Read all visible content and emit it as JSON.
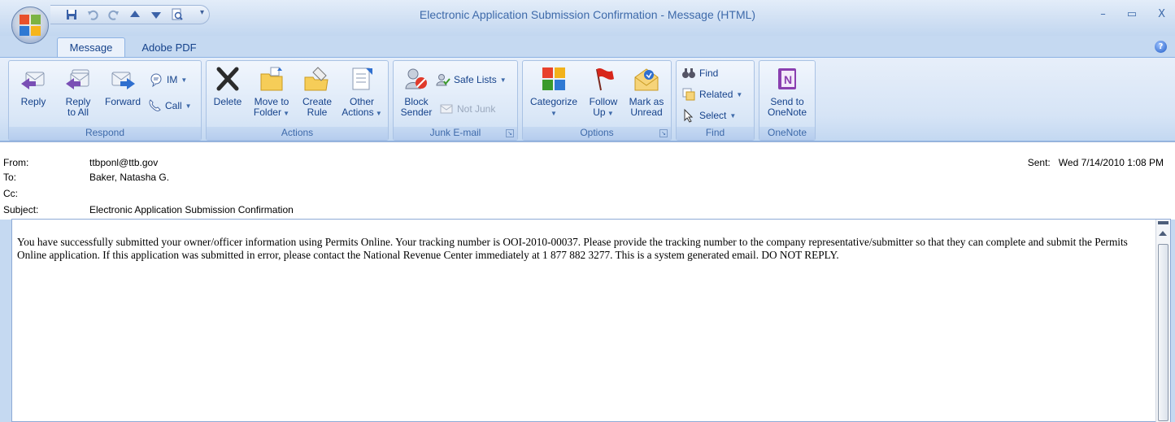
{
  "window": {
    "title": "Electronic Application Submission Confirmation - Message (HTML)",
    "minimize_glyph": "–",
    "maximize_glyph": "▭",
    "close_glyph": "X"
  },
  "quick_access": {
    "save_icon": "save-icon",
    "undo_icon": "undo-icon",
    "redo_icon": "redo-icon",
    "previous_icon": "previous-item-icon",
    "next_icon": "next-item-icon",
    "print_preview_icon": "print-preview-icon",
    "customize_glyph": "▾"
  },
  "tabs": [
    {
      "label": "Message",
      "active": true
    },
    {
      "label": "Adobe PDF",
      "active": false
    }
  ],
  "help_glyph": "?",
  "ribbon": {
    "respond": {
      "label": "Respond",
      "reply": "Reply",
      "reply_all_line1": "Reply",
      "reply_all_line2": "to All",
      "forward": "Forward",
      "im": "IM",
      "call": "Call"
    },
    "actions": {
      "label": "Actions",
      "delete": "Delete",
      "move_line1": "Move to",
      "move_line2": "Folder",
      "rule_line1": "Create",
      "rule_line2": "Rule",
      "other_line1": "Other",
      "other_line2": "Actions"
    },
    "junk": {
      "label": "Junk E-mail",
      "block_line1": "Block",
      "block_line2": "Sender",
      "safe_lists": "Safe Lists",
      "not_junk": "Not Junk"
    },
    "options": {
      "label": "Options",
      "categorize": "Categorize",
      "follow_line1": "Follow",
      "follow_line2": "Up",
      "mark_line1": "Mark as",
      "mark_line2": "Unread"
    },
    "find": {
      "label": "Find",
      "find": "Find",
      "related": "Related",
      "select": "Select"
    },
    "onenote": {
      "label": "OneNote",
      "send_line1": "Send to",
      "send_line2": "OneNote"
    }
  },
  "header": {
    "from_label": "From:",
    "from_value": "ttbponl@ttb.gov",
    "to_label": "To:",
    "to_value": "Baker, Natasha G.",
    "cc_label": "Cc:",
    "cc_value": "",
    "subject_label": "Subject:",
    "subject_value": "Electronic Application Submission Confirmation",
    "sent_label": "Sent:",
    "sent_value": "Wed 7/14/2010 1:08 PM"
  },
  "message": {
    "body": "You have successfully submitted your owner/officer information using Permits Online. Your tracking number is OOI-2010-00037. Please provide the tracking number to the company representative/submitter so that they can complete and submit the Permits Online application. If this application was submitted in error, please contact the National Revenue Center immediately at 1 877 882 3277. This is a system generated email. DO NOT REPLY."
  },
  "colors": {
    "accent": "#15428b",
    "ribbon_bg": "#dae7f7",
    "group_border": "#a9c2e4"
  }
}
